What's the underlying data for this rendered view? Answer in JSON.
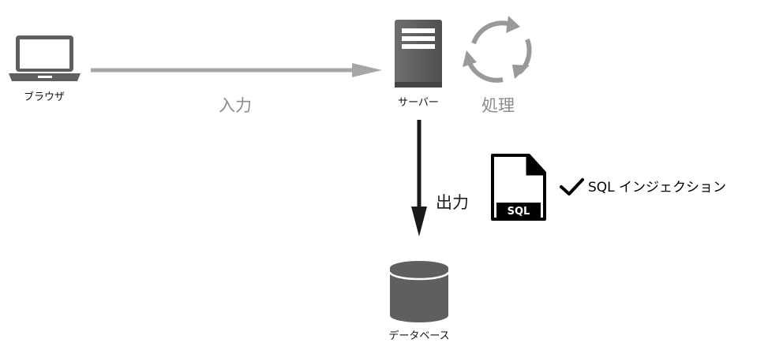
{
  "nodes": {
    "browser": {
      "label": "ブラウザ",
      "icon": "laptop-icon"
    },
    "server": {
      "label": "サーバー",
      "icon": "server-icon"
    },
    "database": {
      "label": "データベース",
      "icon": "database-icon"
    },
    "process": {
      "label": "処理",
      "icon": "cycle-arrows-icon"
    },
    "sql_file": {
      "label": "SQL",
      "icon": "sql-file-icon"
    }
  },
  "edges": {
    "input": {
      "label": "入力",
      "from": "browser",
      "to": "server",
      "color": "#a6a6a6"
    },
    "output": {
      "label": "出力",
      "from": "server",
      "to": "database",
      "color": "#1a1a1a"
    }
  },
  "annotation": {
    "icon": "checkmark-icon",
    "text": "SQL インジェクション"
  },
  "colors": {
    "icon_dark": "#5f5f5f",
    "icon_gray": "#999999",
    "label_gray": "#8c8c8c",
    "black": "#000000"
  }
}
